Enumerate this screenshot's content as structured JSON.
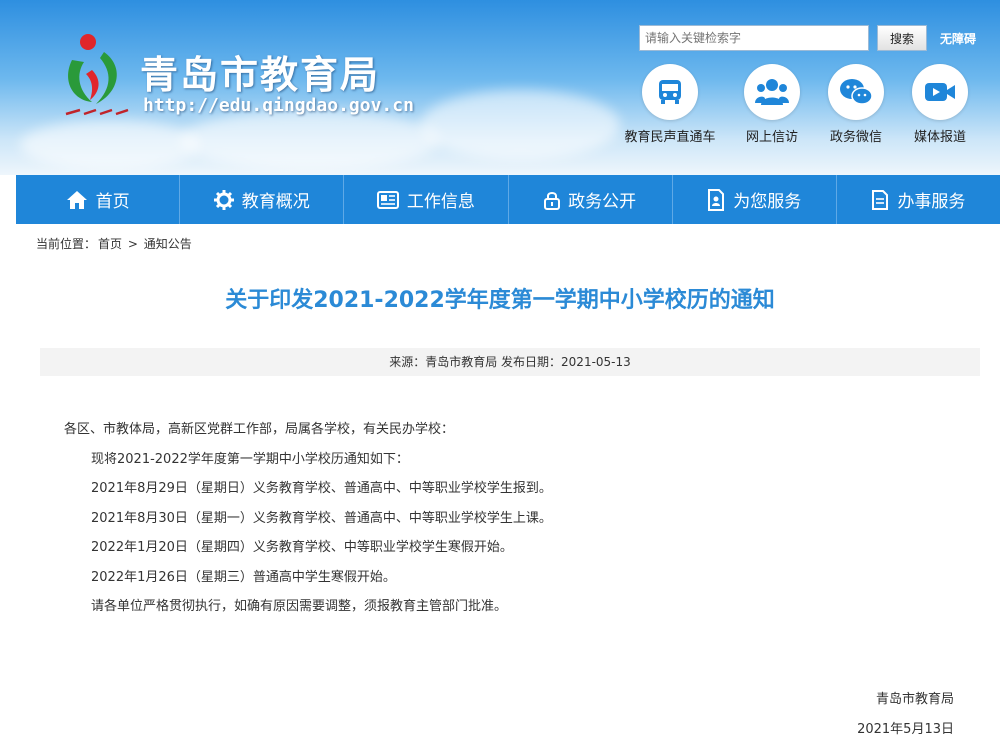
{
  "header": {
    "site_title": "青岛市教育局",
    "site_url": "http://edu.qingdao.gov.cn",
    "search_placeholder": "请输入关键检索字",
    "search_button": "搜索",
    "accessibility_link": "无障碍",
    "quick_links": [
      {
        "label": "教育民声直通车",
        "icon": "bus-icon"
      },
      {
        "label": "网上信访",
        "icon": "users-icon"
      },
      {
        "label": "政务微信",
        "icon": "wechat-icon"
      },
      {
        "label": "媒体报道",
        "icon": "video-icon"
      }
    ]
  },
  "nav": [
    {
      "label": "首页",
      "icon": "home-icon"
    },
    {
      "label": "教育概况",
      "icon": "gear-icon"
    },
    {
      "label": "工作信息",
      "icon": "newspaper-icon"
    },
    {
      "label": "政务公开",
      "icon": "lock-icon"
    },
    {
      "label": "为您服务",
      "icon": "document-person-icon"
    },
    {
      "label": "办事服务",
      "icon": "file-icon"
    }
  ],
  "breadcrumb": {
    "prefix": "当前位置：",
    "items": [
      "首页",
      "通知公告"
    ],
    "separator": ">"
  },
  "article": {
    "title": "关于印发2021-2022学年度第一学期中小学校历的通知",
    "meta": "来源：青岛市教育局 发布日期：2021-05-13",
    "paragraphs": [
      "各区、市教体局，高新区党群工作部，局属各学校，有关民办学校：",
      "现将2021-2022学年度第一学期中小学校历通知如下：",
      "2021年8月29日（星期日）义务教育学校、普通高中、中等职业学校学生报到。",
      "2021年8月30日（星期一）义务教育学校、普通高中、中等职业学校学生上课。",
      "2022年1月20日（星期四）义务教育学校、中等职业学校学生寒假开始。",
      "2022年1月26日（星期三）普通高中学生寒假开始。",
      "请各单位严格贯彻执行，如确有原因需要调整，须报教育主管部门批准。"
    ],
    "signature": "青岛市教育局",
    "date": "2021年5月13日"
  },
  "colors": {
    "accent": "#1f86d9",
    "title": "#2b8ad6"
  }
}
